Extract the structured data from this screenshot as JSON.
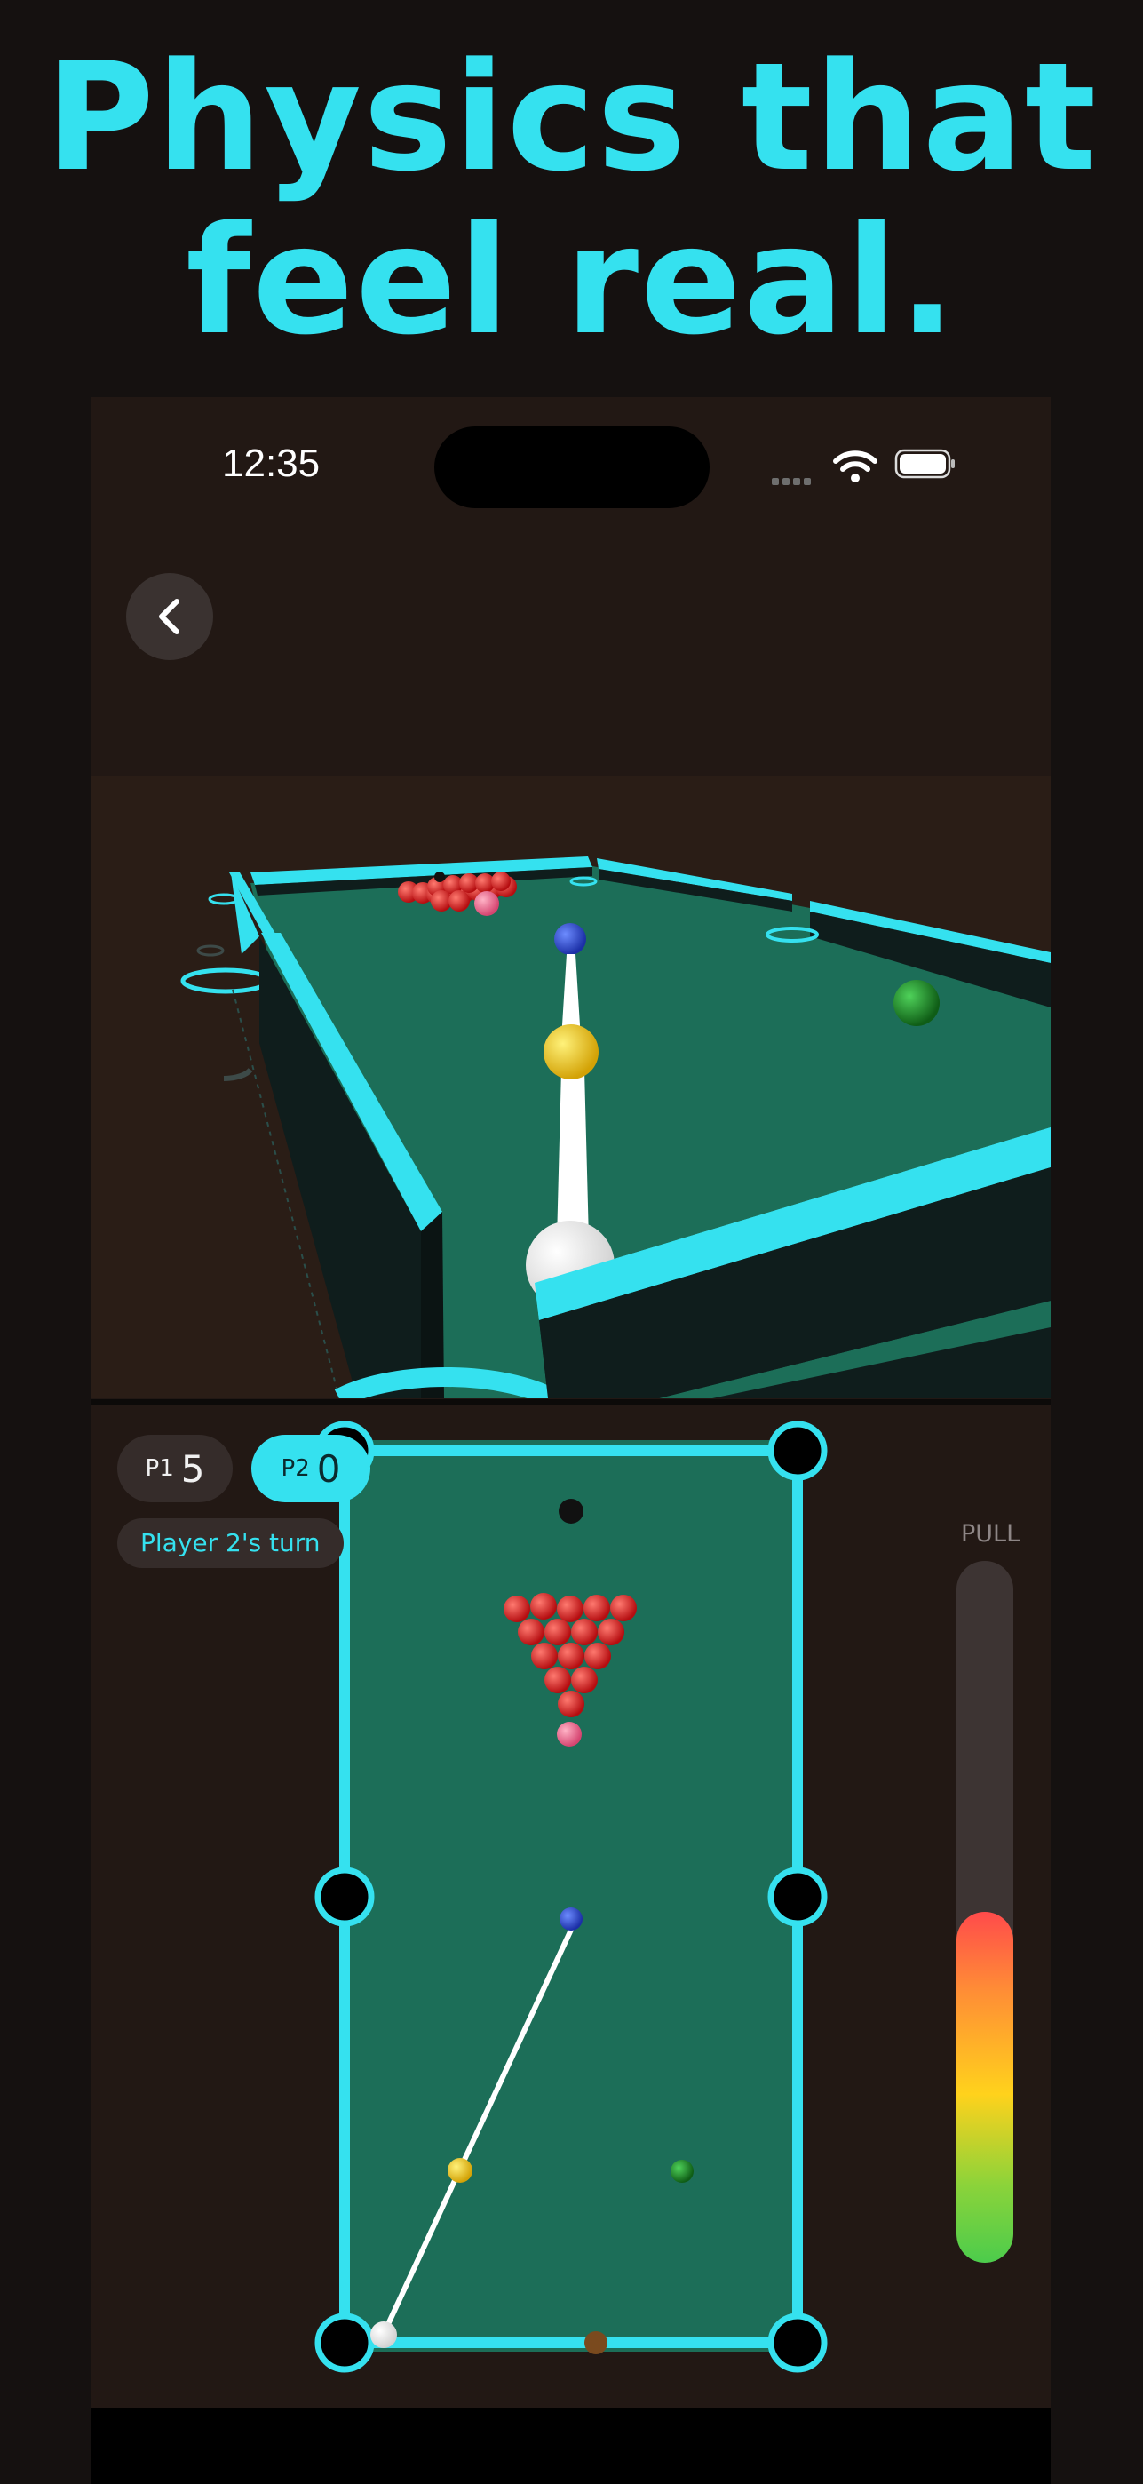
{
  "headline": {
    "line1": "Physics that",
    "line2": "feel real."
  },
  "status_bar": {
    "time": "12:35"
  },
  "scoreboard": {
    "p1": {
      "label": "P1",
      "score": "5"
    },
    "p2": {
      "label": "P2",
      "score": "0",
      "active": true
    },
    "turn_text": "Player 2's turn"
  },
  "power_meter": {
    "label": "PULL",
    "level": 0.5
  },
  "colors": {
    "accent_cyan": "#35e1ef",
    "felt_green": "#1c6e58",
    "background": "#221814"
  },
  "icons": {
    "back": "chevron-left-icon",
    "wifi": "wifi-icon",
    "battery": "battery-icon",
    "signal": "signal-dots-icon"
  }
}
